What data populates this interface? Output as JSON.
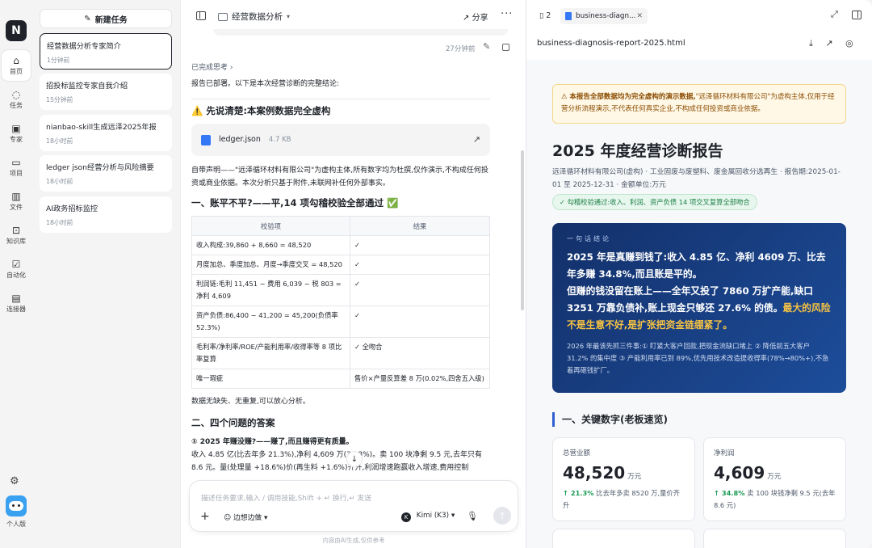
{
  "rail": {
    "logo": "N",
    "items": [
      {
        "label": "首页",
        "icon": "⌂"
      },
      {
        "label": "任务",
        "icon": "◌"
      },
      {
        "label": "专家",
        "icon": "▣"
      },
      {
        "label": "项目",
        "icon": "▭"
      },
      {
        "label": "文件",
        "icon": "▥"
      },
      {
        "label": "知识库",
        "icon": "⊡"
      },
      {
        "label": "自动化",
        "icon": "☑"
      },
      {
        "label": "连接器",
        "icon": "▤"
      }
    ],
    "user_label": "个人版"
  },
  "tasks": {
    "new_task": "新建任务",
    "items": [
      {
        "title": "经营数据分析专家简介",
        "time": "1分钟前"
      },
      {
        "title": "招投标监控专家自我介绍",
        "time": "15分钟前"
      },
      {
        "title": "nianbao-skill生成远泽2025年报",
        "time": "18小时前"
      },
      {
        "title": "ledger json经营分析与风险摘要",
        "time": "18小时前"
      },
      {
        "title": "AI政务招标监控",
        "time": "18小时前"
      }
    ]
  },
  "chat": {
    "title": "经营数据分析",
    "share": "分享",
    "time_ago": "27分钟前",
    "thought": "已完成思考",
    "intro": "报告已部署。以下是本次经营诊断的完整结论:",
    "h_disclaimer": "⚠️ 先说清楚:本案例数据完全虚构",
    "file": {
      "name": "ledger.json",
      "size": "4.7 KB"
    },
    "disclaimer": "自带声明——\"远泽循环材料有限公司\"为虚构主体,所有数字均为杜撰,仅作演示,不构成任何投资或商业依据。本次分析只基于附件,未联网补任何外部事实。",
    "h_audit": "一、账平不平?——平,14 项勾稽校验全部通过 ✅",
    "audit_headers": [
      "校验项",
      "结果"
    ],
    "audit_rows": [
      [
        "收入构成:39,860 + 8,660 = 48,520",
        "✓"
      ],
      [
        "月度加总、季度加总、月度→季度交叉 = 48,520",
        "✓"
      ],
      [
        "利润链:毛利 11,451 − 费用 6,039 − 税 803 = 净利 4,609",
        "✓"
      ],
      [
        "资产负债:86,400 − 41,200 = 45,200(负债率 52.3%)",
        "✓"
      ],
      [
        "毛利率/净利率/ROE/产能利用率/收得率等 8 项比率复算",
        "✓ 全吻合"
      ],
      [
        "唯一瑕疵",
        "售价×产量反算差 8 万(0.02%,四舍五入级)"
      ]
    ],
    "audit_note": "数据无缺失、无重复,可以放心分析。",
    "h_answers": "二、四个问题的答案",
    "q1": "① 2025 年赚没赚?——赚了,而且赚得更有质量。",
    "q1_body": "收入 4.85 亿(比去年多 21.3%),净利 4,609 万(34.8%)。卖 100 块净剩 9.5 元,去年只有 8.6 元。量(处理量 +18.6%)价(再生料 +1.6%)齐升,利润增速跑赢收入增速,费用控制",
    "composer_placeholder": "描述任务要求,输入 / 调用技能,Shift + ↵ 换行,↵ 发送",
    "mode": "边想边做",
    "model": "Kimi (K3)",
    "footnote": "内容由AI生成,仅供参考"
  },
  "preview": {
    "tab_count": "2",
    "tab_title": "business-diagn...",
    "file_path": "business-diagnosis-report-2025.html",
    "warning_bold": "本报告全部数据均为完全虚构的演示数据,",
    "warning_rest": "\"远泽循环材料有限公司\"为虚构主体,仅用于经营分析流程演示,不代表任何真实企业,不构成任何投资或商业依据。",
    "report_title": "2025 年度经营诊断报告",
    "report_sub": "远泽循环材料有限公司(虚构) · 工业固废与废塑料、废金属回收分选再生 · 报告期:2025-01-01 至 2025-12-31 · 金额单位:万元",
    "check_badge": "✓ 勾稽校验通过:收入、利润、资产负债 14 项交叉复算全部吻合",
    "conclusion_label": "一句话结论",
    "conclusion_p1": "2025 年是真赚到钱了:收入 4.85 亿、净利 4609 万、比去年多赚 34.8%,而且账是平的。",
    "conclusion_p2": "但赚的钱没留在账上——全年又投了 7860 万扩产能,缺口 3251 万靠负债补,账上现金只够还 27.6% 的债。",
    "conclusion_highlight": "最大的风险不是生意不好,是扩张把资金链绷紧了。",
    "conclusion_small": "2026 年最该先抓三件事:① 盯紧大客户回款,把现金流缺口堵上 ② 降低前五大客户 31.2% 的集中度 ③ 产能利用率已到 89%,优先用技术改造提收得率(78%→80%+),不急着再砸钱扩厂。",
    "section_title": "一、关键数字(老板速览)",
    "kpis": [
      {
        "label": "总营业额",
        "value": "48,520",
        "unit": "万元",
        "delta": "↑ 21.3%",
        "note": "比去年多卖 8520 万,量价齐升"
      },
      {
        "label": "净利润",
        "value": "4,609",
        "unit": "万元",
        "delta": "↑ 34.8%",
        "note": "卖 100 块钱净剩 9.5 元(去年 8.6 元)"
      }
    ]
  }
}
